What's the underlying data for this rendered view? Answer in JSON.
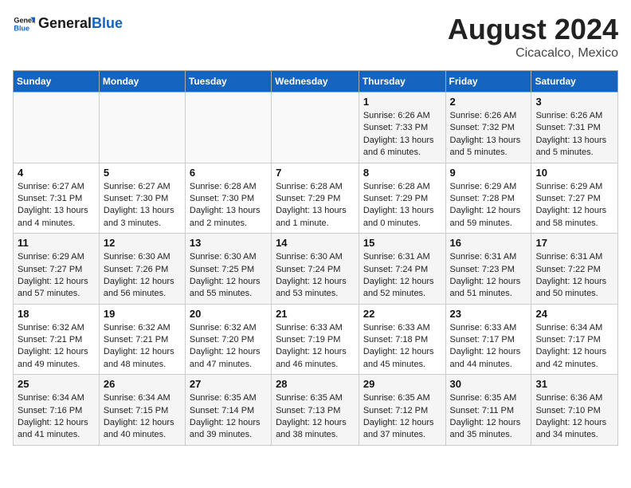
{
  "header": {
    "logo_general": "General",
    "logo_blue": "Blue",
    "month": "August 2024",
    "location": "Cicacalco, Mexico"
  },
  "days_of_week": [
    "Sunday",
    "Monday",
    "Tuesday",
    "Wednesday",
    "Thursday",
    "Friday",
    "Saturday"
  ],
  "weeks": [
    [
      {
        "day": "",
        "info": ""
      },
      {
        "day": "",
        "info": ""
      },
      {
        "day": "",
        "info": ""
      },
      {
        "day": "",
        "info": ""
      },
      {
        "day": "1",
        "info": "Sunrise: 6:26 AM\nSunset: 7:33 PM\nDaylight: 13 hours and 6 minutes."
      },
      {
        "day": "2",
        "info": "Sunrise: 6:26 AM\nSunset: 7:32 PM\nDaylight: 13 hours and 5 minutes."
      },
      {
        "day": "3",
        "info": "Sunrise: 6:26 AM\nSunset: 7:31 PM\nDaylight: 13 hours and 5 minutes."
      }
    ],
    [
      {
        "day": "4",
        "info": "Sunrise: 6:27 AM\nSunset: 7:31 PM\nDaylight: 13 hours and 4 minutes."
      },
      {
        "day": "5",
        "info": "Sunrise: 6:27 AM\nSunset: 7:30 PM\nDaylight: 13 hours and 3 minutes."
      },
      {
        "day": "6",
        "info": "Sunrise: 6:28 AM\nSunset: 7:30 PM\nDaylight: 13 hours and 2 minutes."
      },
      {
        "day": "7",
        "info": "Sunrise: 6:28 AM\nSunset: 7:29 PM\nDaylight: 13 hours and 1 minute."
      },
      {
        "day": "8",
        "info": "Sunrise: 6:28 AM\nSunset: 7:29 PM\nDaylight: 13 hours and 0 minutes."
      },
      {
        "day": "9",
        "info": "Sunrise: 6:29 AM\nSunset: 7:28 PM\nDaylight: 12 hours and 59 minutes."
      },
      {
        "day": "10",
        "info": "Sunrise: 6:29 AM\nSunset: 7:27 PM\nDaylight: 12 hours and 58 minutes."
      }
    ],
    [
      {
        "day": "11",
        "info": "Sunrise: 6:29 AM\nSunset: 7:27 PM\nDaylight: 12 hours and 57 minutes."
      },
      {
        "day": "12",
        "info": "Sunrise: 6:30 AM\nSunset: 7:26 PM\nDaylight: 12 hours and 56 minutes."
      },
      {
        "day": "13",
        "info": "Sunrise: 6:30 AM\nSunset: 7:25 PM\nDaylight: 12 hours and 55 minutes."
      },
      {
        "day": "14",
        "info": "Sunrise: 6:30 AM\nSunset: 7:24 PM\nDaylight: 12 hours and 53 minutes."
      },
      {
        "day": "15",
        "info": "Sunrise: 6:31 AM\nSunset: 7:24 PM\nDaylight: 12 hours and 52 minutes."
      },
      {
        "day": "16",
        "info": "Sunrise: 6:31 AM\nSunset: 7:23 PM\nDaylight: 12 hours and 51 minutes."
      },
      {
        "day": "17",
        "info": "Sunrise: 6:31 AM\nSunset: 7:22 PM\nDaylight: 12 hours and 50 minutes."
      }
    ],
    [
      {
        "day": "18",
        "info": "Sunrise: 6:32 AM\nSunset: 7:21 PM\nDaylight: 12 hours and 49 minutes."
      },
      {
        "day": "19",
        "info": "Sunrise: 6:32 AM\nSunset: 7:21 PM\nDaylight: 12 hours and 48 minutes."
      },
      {
        "day": "20",
        "info": "Sunrise: 6:32 AM\nSunset: 7:20 PM\nDaylight: 12 hours and 47 minutes."
      },
      {
        "day": "21",
        "info": "Sunrise: 6:33 AM\nSunset: 7:19 PM\nDaylight: 12 hours and 46 minutes."
      },
      {
        "day": "22",
        "info": "Sunrise: 6:33 AM\nSunset: 7:18 PM\nDaylight: 12 hours and 45 minutes."
      },
      {
        "day": "23",
        "info": "Sunrise: 6:33 AM\nSunset: 7:17 PM\nDaylight: 12 hours and 44 minutes."
      },
      {
        "day": "24",
        "info": "Sunrise: 6:34 AM\nSunset: 7:17 PM\nDaylight: 12 hours and 42 minutes."
      }
    ],
    [
      {
        "day": "25",
        "info": "Sunrise: 6:34 AM\nSunset: 7:16 PM\nDaylight: 12 hours and 41 minutes."
      },
      {
        "day": "26",
        "info": "Sunrise: 6:34 AM\nSunset: 7:15 PM\nDaylight: 12 hours and 40 minutes."
      },
      {
        "day": "27",
        "info": "Sunrise: 6:35 AM\nSunset: 7:14 PM\nDaylight: 12 hours and 39 minutes."
      },
      {
        "day": "28",
        "info": "Sunrise: 6:35 AM\nSunset: 7:13 PM\nDaylight: 12 hours and 38 minutes."
      },
      {
        "day": "29",
        "info": "Sunrise: 6:35 AM\nSunset: 7:12 PM\nDaylight: 12 hours and 37 minutes."
      },
      {
        "day": "30",
        "info": "Sunrise: 6:35 AM\nSunset: 7:11 PM\nDaylight: 12 hours and 35 minutes."
      },
      {
        "day": "31",
        "info": "Sunrise: 6:36 AM\nSunset: 7:10 PM\nDaylight: 12 hours and 34 minutes."
      }
    ]
  ]
}
